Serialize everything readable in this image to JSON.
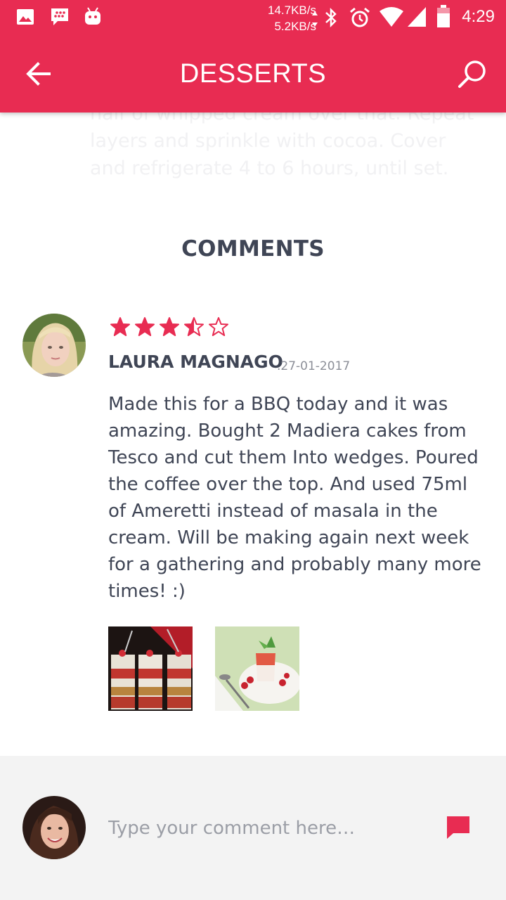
{
  "status_bar": {
    "net_up": "14.7KB/s",
    "net_down": "5.2KB/s",
    "time": "4:29",
    "icons": [
      "image-icon",
      "bbm-icon",
      "android-icon",
      "bluetooth-icon",
      "alarm-icon",
      "wifi-icon",
      "signal-icon",
      "battery-icon"
    ]
  },
  "app_bar": {
    "title": "DESSERTS",
    "back_icon": "arrow-left-icon",
    "search_icon": "search-icon"
  },
  "recipe_tail": {
    "text": "half of whipped cream over that. Repeat layers and sprinkle with cocoa. Cover and refrigerate 4 to 6 hours, until set."
  },
  "comments": {
    "heading": "COMMENTS",
    "items": [
      {
        "rating": 3.5,
        "rating_max": 5,
        "author": "LAURA MAGNAGO",
        "date": ".27-01-2017",
        "text": "Made this for a BBQ today and it was amazing. Bought 2 Madiera cakes from Tesco and cut them Into wedges. Poured the coffee over the top. And used 75ml of Ameretti instead of masala in the cream. Will be making again next week for a gathering and probably many more times! :)",
        "photos": [
          "parfait-glasses-photo",
          "panna-cotta-photo"
        ]
      }
    ]
  },
  "composer": {
    "placeholder": "Type your comment here…",
    "send_icon": "chat-bubble-icon"
  },
  "colors": {
    "accent": "#e82c52",
    "text": "#3f4555",
    "muted": "#8c8f98",
    "footer_bg": "#f3f3f3"
  }
}
